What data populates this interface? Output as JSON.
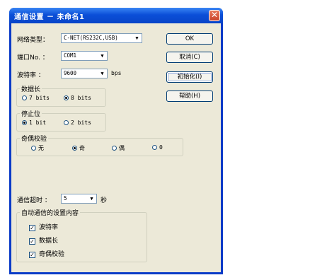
{
  "window": {
    "title": "通信设置 － 未命名1"
  },
  "form": {
    "network_type": {
      "label": "网络类型：",
      "value": "C-NET(RS232C,USB)"
    },
    "port": {
      "label": "端口No. ：",
      "value": "COM1"
    },
    "baud": {
      "label": "波特率  ：",
      "value": "9600",
      "unit": "bps"
    },
    "data_length": {
      "legend": "数据长",
      "options": [
        "7 bits",
        "8 bits"
      ],
      "selected": "8 bits"
    },
    "stop_bit": {
      "legend": "停止位",
      "options": [
        "1 bit",
        "2 bits"
      ],
      "selected": "1 bit"
    },
    "parity": {
      "legend": "奇偶校验",
      "options": [
        "无",
        "奇",
        "偶",
        "0"
      ],
      "selected": "奇"
    },
    "timeout": {
      "label": "通信超时 ：",
      "value": "5",
      "unit": "秒"
    },
    "auto_settings": {
      "legend": "自动通信的设置内容",
      "items": [
        {
          "label": "波特率",
          "checked": true
        },
        {
          "label": "数据长",
          "checked": true
        },
        {
          "label": "奇偶校验",
          "checked": true
        }
      ]
    }
  },
  "buttons": {
    "ok": "OK",
    "cancel": "取消(C)",
    "init": "初始化(I)",
    "help": "帮助(H)"
  },
  "icons": {
    "close": "close-icon",
    "dropdown": "chevron-down-icon"
  }
}
